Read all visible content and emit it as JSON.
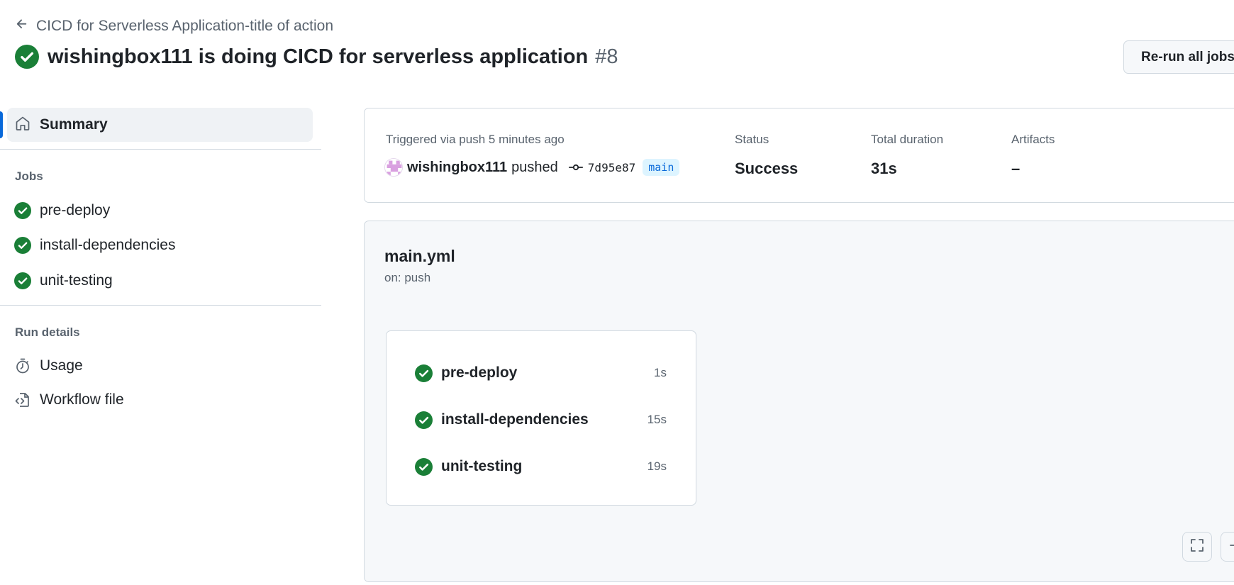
{
  "header": {
    "breadcrumb": "CICD for Serverless Application-title of action",
    "title": "wishingbox111 is doing CICD for serverless application",
    "run_number": "#8",
    "rerun_label": "Re-run all jobs"
  },
  "sidebar": {
    "summary_label": "Summary",
    "jobs_heading": "Jobs",
    "jobs": [
      {
        "label": "pre-deploy",
        "icon": "check-circle-icon"
      },
      {
        "label": "install-dependencies",
        "icon": "check-circle-icon"
      },
      {
        "label": "unit-testing",
        "icon": "check-circle-icon"
      }
    ],
    "run_details_heading": "Run details",
    "usage_label": "Usage",
    "workflow_file_label": "Workflow file"
  },
  "summary": {
    "trigger_text": "Triggered via push 5 minutes ago",
    "actor": "wishingbox111",
    "action": "pushed",
    "commit_sha": "7d95e87",
    "branch": "main",
    "status_label": "Status",
    "status_value": "Success",
    "duration_label": "Total duration",
    "duration_value": "31s",
    "artifacts_label": "Artifacts",
    "artifacts_value": "–"
  },
  "workflow": {
    "name": "main.yml",
    "trigger": "on: push",
    "jobs": [
      {
        "name": "pre-deploy",
        "duration": "1s"
      },
      {
        "name": "install-dependencies",
        "duration": "15s"
      },
      {
        "name": "unit-testing",
        "duration": "19s"
      }
    ]
  },
  "colors": {
    "success_green": "#1a7f37",
    "accent_blue": "#0969da",
    "muted_text": "#59636e",
    "border": "#d1d9e0"
  }
}
